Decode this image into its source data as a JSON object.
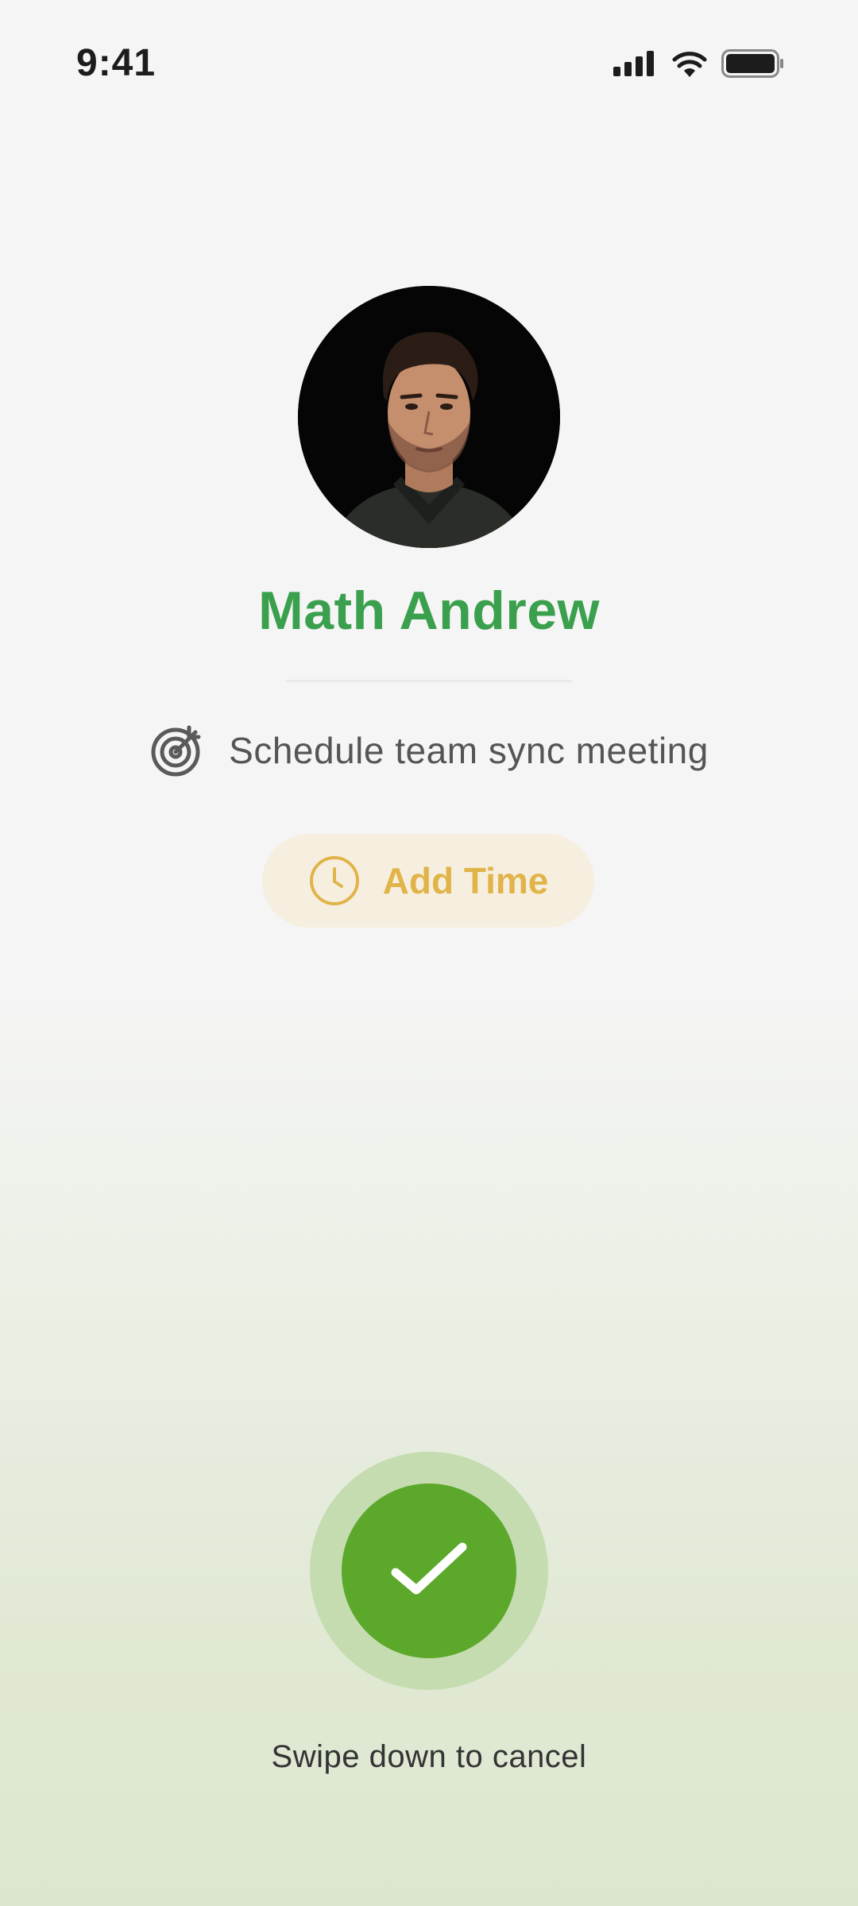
{
  "status_bar": {
    "time": "9:41",
    "icons": [
      "signal-icon",
      "wifi-icon",
      "battery-icon"
    ]
  },
  "contact": {
    "name": "Math Andrew",
    "avatar_icon": "avatar-photo"
  },
  "task": {
    "icon": "target-icon",
    "text": "Schedule team sync meeting"
  },
  "add_time": {
    "icon": "clock-icon",
    "label": "Add Time"
  },
  "confirm": {
    "icon": "checkmark-icon",
    "hint": "Swipe down to cancel"
  },
  "colors": {
    "accent_green": "#3aa04e",
    "button_green": "#5ba82b",
    "add_time_gold": "#e1b44a"
  }
}
